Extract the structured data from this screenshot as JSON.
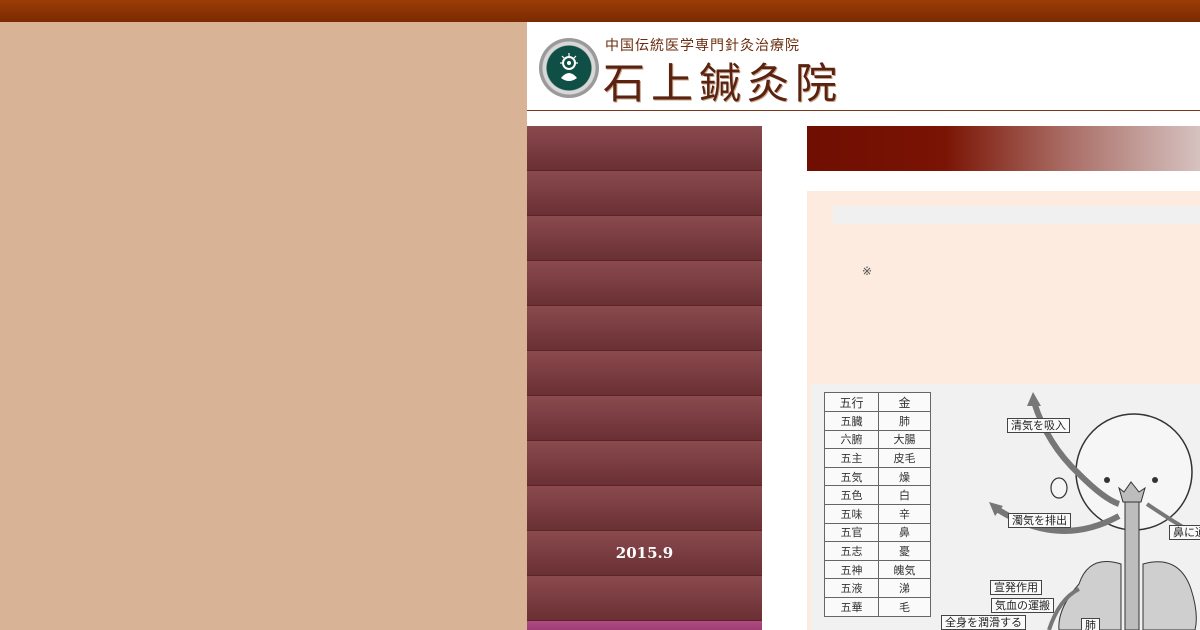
{
  "header": {
    "subtitle": "中国伝統医学専門針灸治療院",
    "title": "石上鍼灸院"
  },
  "nav": {
    "items": [
      "",
      "",
      "",
      "",
      "",
      "",
      "",
      "",
      "",
      "2015.9",
      ""
    ]
  },
  "content": {
    "note": "※"
  },
  "figure": {
    "table": {
      "header": [
        "五行",
        "金"
      ],
      "rows": [
        [
          "五臓",
          "肺"
        ],
        [
          "六腑",
          "大腸"
        ],
        [
          "五主",
          "皮毛"
        ],
        [
          "五気",
          "燥"
        ],
        [
          "五色",
          "白"
        ],
        [
          "五味",
          "辛"
        ],
        [
          "五官",
          "鼻"
        ],
        [
          "五志",
          "憂"
        ],
        [
          "五神",
          "魄気"
        ],
        [
          "五液",
          "涕"
        ],
        [
          "五華",
          "毛"
        ]
      ]
    },
    "labels": {
      "inhale": "清気を吸入",
      "exhale": "濁気を排出",
      "nose": "鼻に通",
      "disperse": "宣発作用",
      "transport": "気血の運搬",
      "moisten": "全身を潤滑する",
      "lung": "肺"
    }
  },
  "colors": {
    "top_bar": "#8a3304",
    "background": "#d8b396",
    "nav": "#7a3c40",
    "content_bg": "#fdebdf",
    "title_bar": "#6f0e02"
  },
  "icons": [
    "clinic-logo-icon"
  ]
}
